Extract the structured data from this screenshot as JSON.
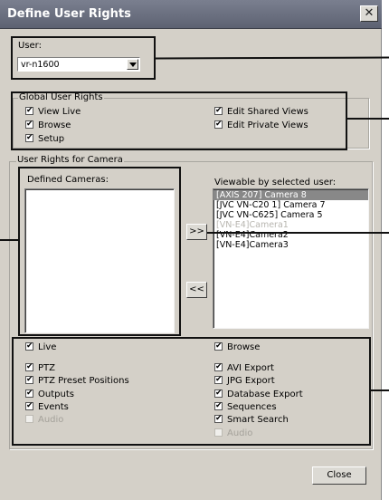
{
  "window": {
    "title": "Define User Rights",
    "close_glyph": "✕"
  },
  "user": {
    "label": "User:",
    "value": "vr-n1600"
  },
  "global": {
    "legend": "Global User Rights",
    "items": [
      {
        "label": "View Live",
        "checked": true
      },
      {
        "label": "Browse",
        "checked": true
      },
      {
        "label": "Setup",
        "checked": true
      },
      {
        "label": "Edit Shared Views",
        "checked": true
      },
      {
        "label": "Edit Private Views",
        "checked": true
      }
    ]
  },
  "camera": {
    "legend": "User Rights for Camera",
    "defined_label": "Defined Cameras:",
    "viewable_label": "Viewable by selected user:",
    "viewable": [
      "[AXIS 207] Camera 8",
      "[JVC VN-C20 1] Camera 7",
      "[JVC VN-C625] Camera 5",
      "[VN-E4]Camera1",
      "[VN-E4]Camera2",
      "[VN-E4]Camera3"
    ],
    "add_label": ">>",
    "remove_label": "<<",
    "rights_left": [
      {
        "label": "Live",
        "checked": true,
        "disabled": false
      },
      {
        "label": "PTZ",
        "checked": true,
        "disabled": false
      },
      {
        "label": "PTZ Preset Positions",
        "checked": true,
        "disabled": false
      },
      {
        "label": "Outputs",
        "checked": true,
        "disabled": false
      },
      {
        "label": "Events",
        "checked": true,
        "disabled": false
      },
      {
        "label": "Audio",
        "checked": false,
        "disabled": true
      }
    ],
    "rights_right": [
      {
        "label": "Browse",
        "checked": true,
        "disabled": false
      },
      {
        "label": "AVI Export",
        "checked": true,
        "disabled": false
      },
      {
        "label": "JPG Export",
        "checked": true,
        "disabled": false
      },
      {
        "label": "Database Export",
        "checked": true,
        "disabled": false
      },
      {
        "label": "Sequences",
        "checked": true,
        "disabled": false
      },
      {
        "label": "Smart Search",
        "checked": true,
        "disabled": false
      },
      {
        "label": "Audio",
        "checked": false,
        "disabled": true
      }
    ]
  },
  "close_label": "Close"
}
